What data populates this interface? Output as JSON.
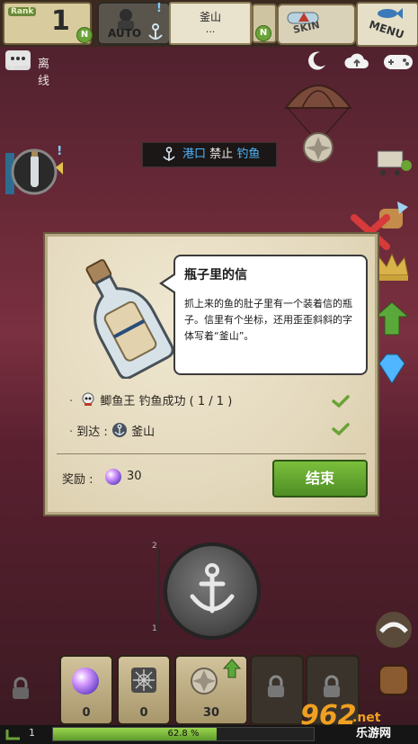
{
  "topbar": {
    "rank_label": "Rank",
    "rank_value": "1",
    "badge_letter": "N",
    "auto_label": "AUTO",
    "location_name": "釜山",
    "location_sub": "...",
    "skin_label": "SKIN",
    "menu_label": "MENU",
    "alert_mark": "!"
  },
  "status": {
    "offline_label": "离线"
  },
  "port_badge": {
    "port": "港口",
    "ban": "禁止",
    "fishing": "钓鱼"
  },
  "modal": {
    "title": "瓶子里的信",
    "body": "抓上来的鱼的肚子里有一个装着信的瓶子。信里有个坐标，还用歪歪斜斜的字体写着“釜山”。",
    "requirement_1": "鲫鱼王 钓鱼成功 ( 1 / 1 )",
    "requirement_2_prefix": "到达 :",
    "requirement_2_place": "釜山",
    "reward_label": "奖励 :",
    "reward_value": "30",
    "end_button": "结束"
  },
  "gauge": {
    "top": "2",
    "bottom": "1"
  },
  "slots": [
    {
      "value": "0",
      "icon": "orb"
    },
    {
      "value": "0",
      "icon": "spiderweb"
    },
    {
      "value": "30",
      "icon": "shell"
    },
    {
      "value": "",
      "icon": "lock"
    },
    {
      "value": "",
      "icon": "lock"
    }
  ],
  "bottom": {
    "level": "1",
    "progress_text": "62.8 %",
    "progress_fraction": 0.628
  },
  "watermark": {
    "brand": "962",
    "suffix": ".net",
    "sub": "乐游网"
  },
  "colors": {
    "accent_green": "#6aa336",
    "port_blue": "#4fb6ff"
  }
}
